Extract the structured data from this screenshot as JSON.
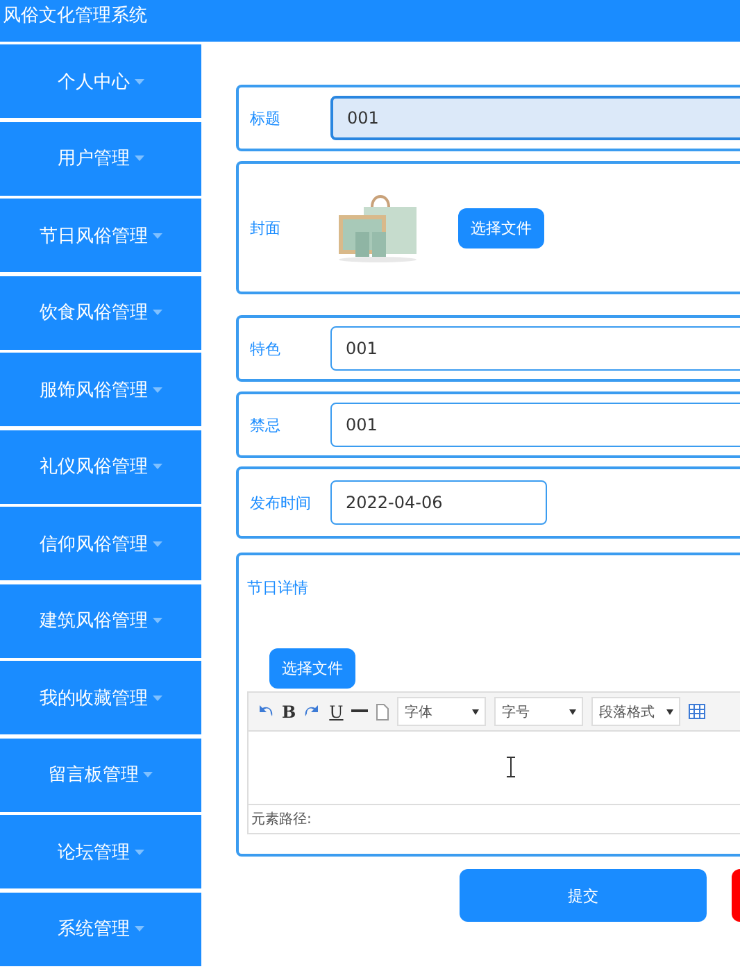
{
  "window": {
    "title": "风俗文化管理系统"
  },
  "sidebar": {
    "items": [
      {
        "label": "个人中心"
      },
      {
        "label": "用户管理"
      },
      {
        "label": "节日风俗管理"
      },
      {
        "label": "饮食风俗管理"
      },
      {
        "label": "服饰风俗管理"
      },
      {
        "label": "礼仪风俗管理"
      },
      {
        "label": "信仰风俗管理"
      },
      {
        "label": "建筑风俗管理"
      },
      {
        "label": "我的收藏管理"
      },
      {
        "label": "留言板管理"
      },
      {
        "label": "论坛管理"
      },
      {
        "label": "系统管理"
      }
    ]
  },
  "form": {
    "fields": [
      {
        "kind": "input",
        "label": "标题",
        "value": "001",
        "readonly": true
      },
      {
        "label": "封面",
        "button": "选择文件"
      },
      {
        "kind": "input",
        "label": "特色",
        "value": "001",
        "readonly": false
      },
      {
        "kind": "input",
        "label": "禁忌",
        "value": "001",
        "readonly": false
      },
      {
        "kind": "date",
        "label": "发布时间",
        "value": "2022-04-06",
        "readonly": false
      },
      {
        "kind": "editor",
        "label": "节日详情",
        "button": "选择文件",
        "status": "元素路径:",
        "toolbar": [
          {
            "kind": "undo"
          },
          {
            "kind": "bold",
            "label": "B"
          },
          {
            "kind": "redo"
          },
          {
            "kind": "underline",
            "label": "U"
          },
          {
            "kind": "rule"
          },
          {
            "kind": "page"
          },
          {
            "kind": "select",
            "label": "字体"
          },
          {
            "kind": "select",
            "label": "字号"
          },
          {
            "kind": "select",
            "label": "段落格式"
          },
          {
            "kind": "table"
          }
        ]
      }
    ],
    "buttons": [
      {
        "kind": "primary",
        "label": "提交"
      },
      {
        "kind": "danger"
      }
    ]
  }
}
